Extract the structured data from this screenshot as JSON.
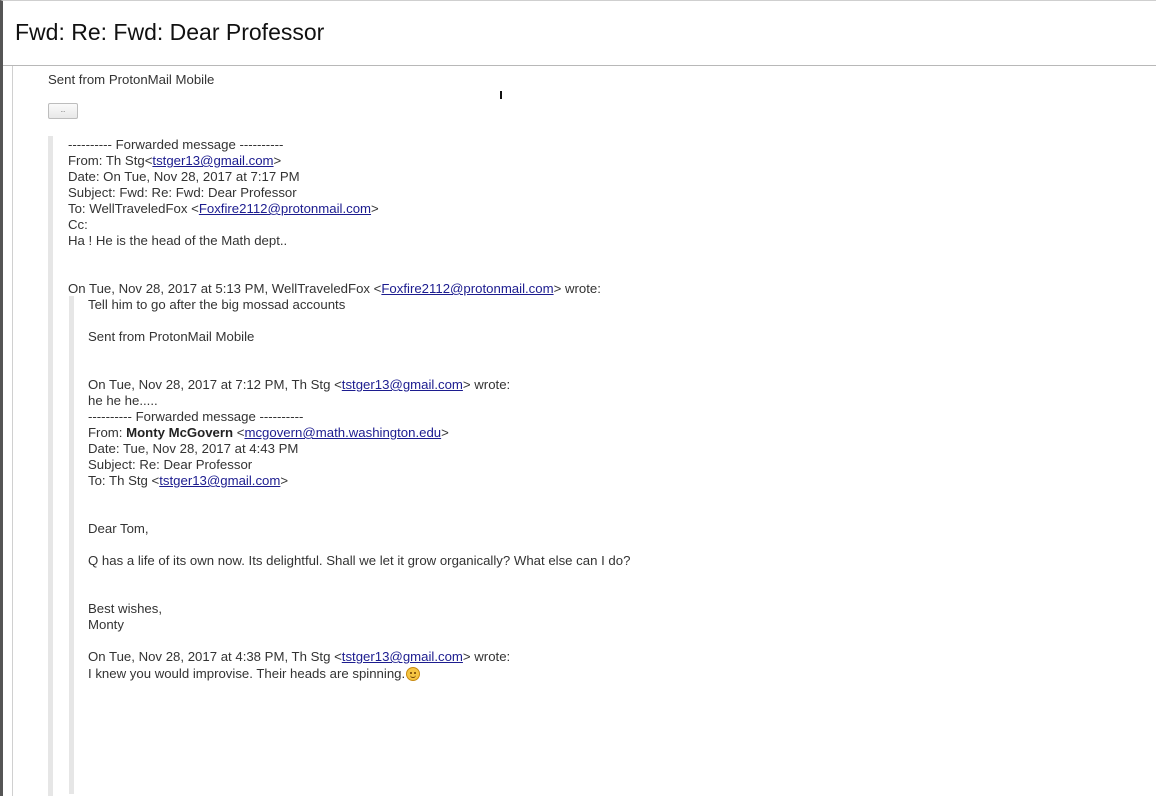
{
  "subject": "Fwd: Re: Fwd: Dear Professor",
  "signature_top": "Sent from ProtonMail Mobile",
  "show_quoted_button": "...",
  "forward1": {
    "separator": "---------- Forwarded message ----------",
    "from_label": "From: Th Stg<",
    "from_email": "tstger13@gmail.com",
    "from_close": ">",
    "date": "Date: On Tue, Nov 28, 2017 at 7:17 PM",
    "subject": "Subject: Fwd: Re: Fwd: Dear Professor",
    "to_label": "To: WellTraveledFox <",
    "to_email": "Foxfire2112@protonmail.com",
    "to_close": ">",
    "cc": "Cc:",
    "body": "Ha !  He is the head of the Math dept.."
  },
  "reply1": {
    "attribution_pre": "On Tue, Nov 28, 2017 at 5:13 PM, WellTraveledFox <",
    "attribution_email": "Foxfire2112@protonmail.com",
    "attribution_post": "> wrote:",
    "body": "Tell him to go after the big mossad accounts",
    "signature": "Sent from ProtonMail Mobile"
  },
  "reply2": {
    "attribution_pre": "On Tue, Nov 28, 2017 at 7:12 PM, Th Stg <",
    "attribution_email": "tstger13@gmail.com",
    "attribution_post": "> wrote:",
    "body": "he he he.....",
    "separator": "---------- Forwarded message ----------",
    "from_label": "From: ",
    "from_name": "Monty McGovern",
    "from_open": " <",
    "from_email": "mcgovern@math.washington.edu",
    "from_close": ">",
    "date": "Date: Tue, Nov 28, 2017 at 4:43 PM",
    "subject": "Subject: Re: Dear Professor",
    "to_label": "To: Th Stg <",
    "to_email": "tstger13@gmail.com",
    "to_close": ">"
  },
  "professor_msg": {
    "greeting": "Dear Tom,",
    "body": "Q has a life of its own now. Its delightful. Shall we let it grow organically? What else can I do?",
    "closing": "Best wishes,",
    "name": "Monty"
  },
  "reply3": {
    "attribution_pre": "On Tue, Nov 28, 2017 at 4:38 PM, Th Stg <",
    "attribution_email": "tstger13@gmail.com",
    "attribution_post": "> wrote:",
    "body": "I knew you would improvise. Their heads are spinning.",
    "emoji_icon": "smiley-face-icon"
  },
  "colors": {
    "link": "#1c1c8f",
    "quote_bar": "#e6e6e6",
    "window_edge": "#555555"
  }
}
